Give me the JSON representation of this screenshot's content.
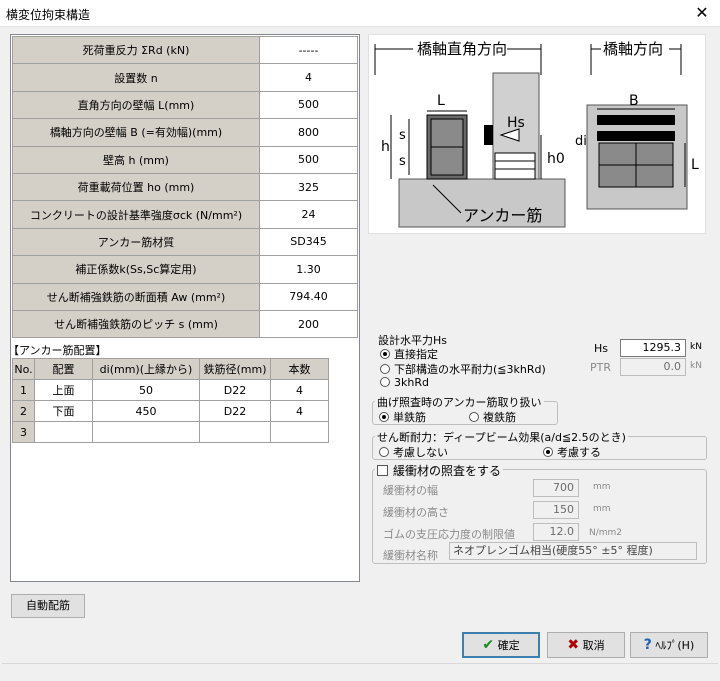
{
  "window": {
    "title": "横変位拘束構造",
    "close": "✕"
  },
  "properties": [
    {
      "label": "死荷重反力 ΣRd (kN)",
      "value": "-----"
    },
    {
      "label": "設置数 n",
      "value": "4"
    },
    {
      "label": "直角方向の壁幅 L(mm)",
      "value": "500"
    },
    {
      "label": "橋軸方向の壁幅 B (=有効幅)(mm)",
      "value": "800"
    },
    {
      "label": "壁高 h (mm)",
      "value": "500"
    },
    {
      "label": "荷重載荷位置 ho (mm)",
      "value": "325"
    },
    {
      "label": "コンクリートの設計基準強度σck (N/mm²)",
      "value": "24"
    },
    {
      "label": "アンカー筋材質",
      "value": "SD345"
    },
    {
      "label": "補正係数k(Ss,Sc算定用)",
      "value": "1.30"
    },
    {
      "label": "せん断補強鉄筋の断面積 Aw (mm²)",
      "value": "794.40"
    },
    {
      "label": "せん断補強鉄筋のピッチ s (mm)",
      "value": "200"
    }
  ],
  "anchor": {
    "title": "【アンカー筋配置】",
    "headers": [
      "No.",
      "配置",
      "di(mm)(上縁から)",
      "鉄筋径(mm)",
      "本数"
    ],
    "rows": [
      {
        "no": "1",
        "pos": "上面",
        "di": "50",
        "dia": "D22",
        "count": "4"
      },
      {
        "no": "2",
        "pos": "下面",
        "di": "450",
        "dia": "D22",
        "count": "4"
      },
      {
        "no": "3",
        "pos": "",
        "di": "",
        "dia": "",
        "count": ""
      }
    ]
  },
  "diagram": {
    "label_perp": "橋軸直角方向",
    "label_axis": "橋軸方向",
    "L": "L",
    "B": "B",
    "Hs": "Hs",
    "h": "h",
    "s": "s",
    "h0": "h0",
    "di": "di",
    "anchor": "アンカー筋"
  },
  "design_hs": {
    "title": "設計水平力Hs",
    "options": [
      "直接指定",
      "下部構造の水平耐力(≦3khRd)",
      "3khRd"
    ],
    "selected": 0
  },
  "hs": {
    "label": "Hs",
    "value": "1295.3",
    "unit": "kN"
  },
  "ptr": {
    "label": "PTR",
    "value": "0.0",
    "unit": "kN"
  },
  "bending": {
    "title": "曲げ照査時のアンカー筋取り扱い",
    "options": [
      "単鉄筋",
      "複鉄筋"
    ],
    "selected": 0
  },
  "shear": {
    "title": "せん断耐力：ディープビーム効果(a/d≦2.5のとき)",
    "options": [
      "考慮しない",
      "考慮する"
    ],
    "selected": 1
  },
  "cushion": {
    "check_label": "緩衝材の照査をする",
    "checked": false,
    "width": {
      "label": "緩衝材の幅",
      "value": "700",
      "unit": "mm"
    },
    "height": {
      "label": "緩衝材の高さ",
      "value": "150",
      "unit": "mm"
    },
    "limit": {
      "label": "ゴムの支圧応力度の制限値",
      "value": "12.0",
      "unit": "N/mm2"
    },
    "name": {
      "label": "緩衝材名称",
      "value": "ネオプレンゴム相当(硬度55° ±5° 程度)"
    }
  },
  "buttons": {
    "auto": "自動配筋",
    "ok": "確定",
    "cancel": "取消",
    "help": "ﾍﾙﾌﾟ(H)"
  }
}
